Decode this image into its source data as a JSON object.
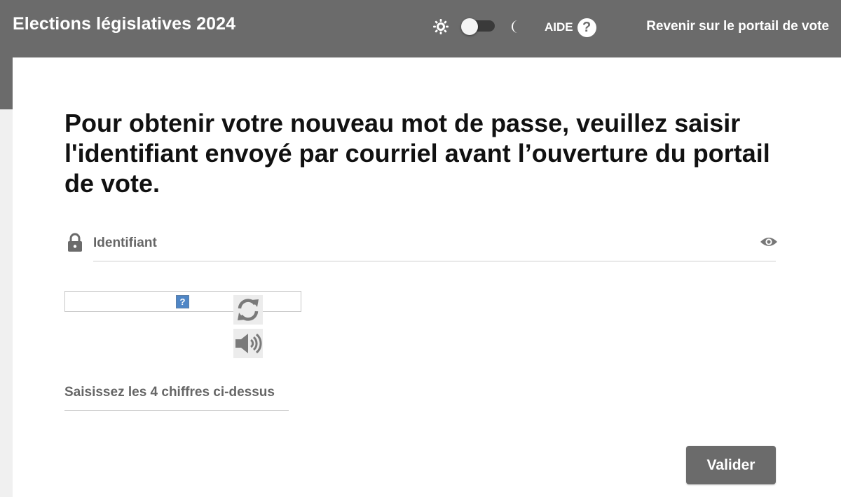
{
  "header": {
    "title": "Elections législatives 2024",
    "help_label": "AIDE",
    "help_icon_glyph": "?",
    "back_link": "Revenir sur le portail de vote",
    "theme_toggle": {
      "sun_icon": "sun-icon",
      "moon_icon": "moon-icon",
      "dark_mode": false
    }
  },
  "main": {
    "instruction": "Pour obtenir votre nouveau mot de passe, veuillez saisir l'identifiant envoyé par courriel avant l’ouverture du portail de vote.",
    "identifier_field": {
      "placeholder": "Identifiant",
      "value": "",
      "leading_icon": "lock-icon",
      "trailing_icon": "eye-icon"
    },
    "captcha": {
      "image_placeholder_glyph": "?",
      "refresh_icon": "refresh-icon",
      "audio_icon": "speaker-icon",
      "input_placeholder": "Saisissez les 4 chiffres ci-dessus",
      "input_value": ""
    },
    "submit_label": "Valider"
  },
  "colors": {
    "header_bg": "#6b6b6b",
    "button_bg": "#6b6b6b",
    "page_bg": "#f0f0f0",
    "card_bg": "#ffffff"
  }
}
